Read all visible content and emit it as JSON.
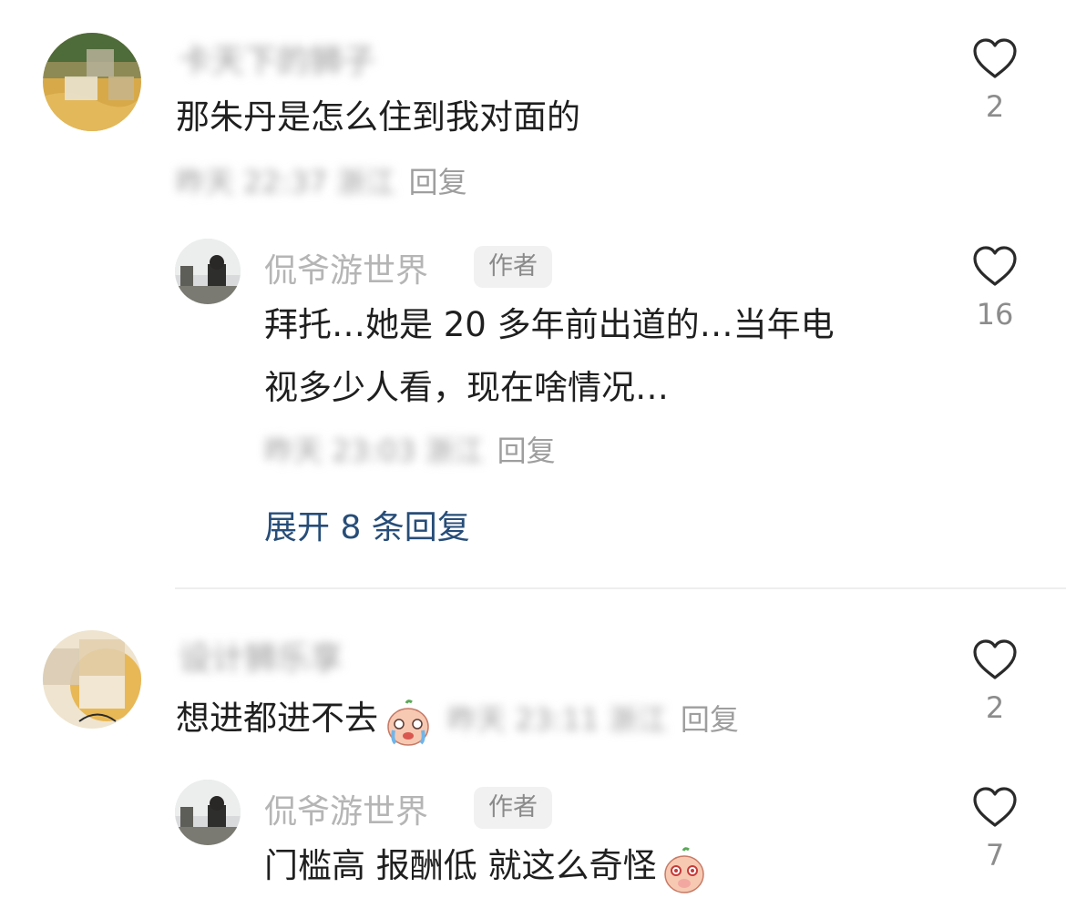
{
  "comments": [
    {
      "username": "卡天下的狮子",
      "text": "那朱丹是怎么住到我对面的",
      "meta": "昨天 22:37 浙江",
      "reply_label": "回复",
      "likes": "2",
      "replies": [
        {
          "username": "侃爷游世界",
          "badge": "作者",
          "text_line1": "拜托…她是 20 多年前出道的…当年电",
          "text_line2": "视多少人看，现在啥情况…",
          "meta": "昨天 23:03 浙江",
          "reply_label": "回复",
          "likes": "16"
        }
      ],
      "expand_label": "展开 8 条回复"
    },
    {
      "username": "设计狮乐享",
      "text": "想进都进不去",
      "meta": "昨天 23:11 浙江",
      "reply_label": "回复",
      "likes": "2",
      "replies": [
        {
          "username": "侃爷游世界",
          "badge": "作者",
          "text_line1": "门槛高 报酬低 就这么奇怪",
          "likes": "7"
        }
      ]
    }
  ],
  "icons": {
    "like": "heart-outline-icon",
    "emoji_crying": "crying-face-emoji",
    "emoji_shy": "shy-face-emoji"
  },
  "colors": {
    "link": "#274d78",
    "muted": "#9e9e9e",
    "text": "#1f1f1f"
  }
}
